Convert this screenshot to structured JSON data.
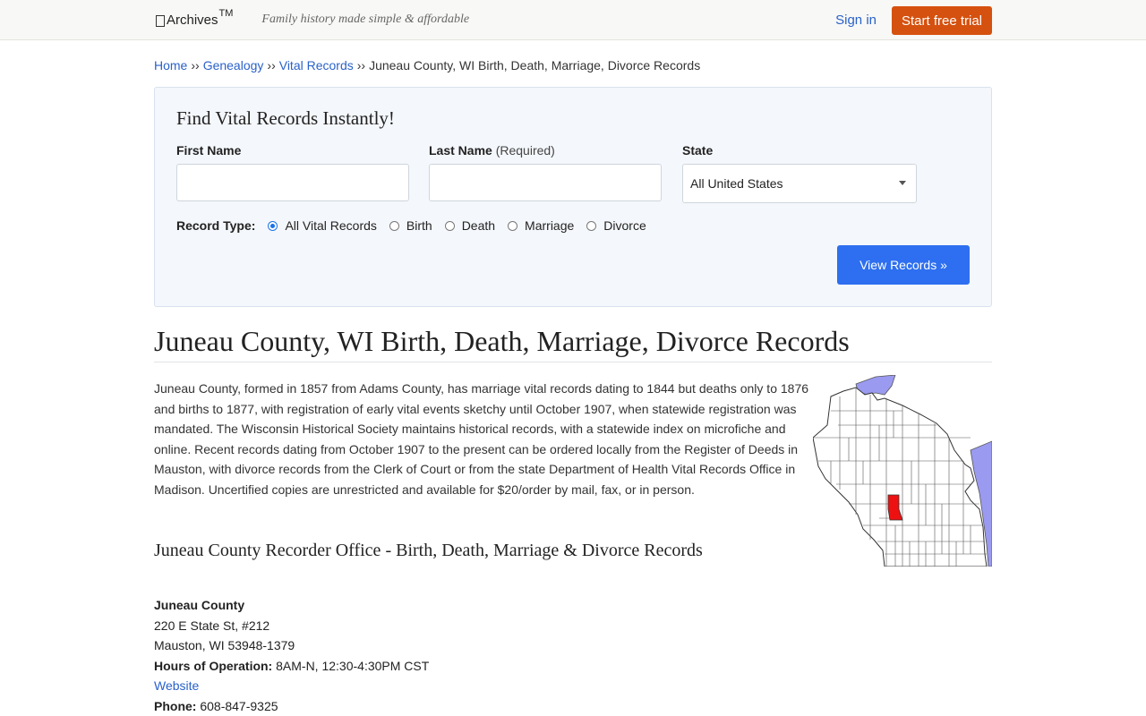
{
  "header": {
    "logo_text": "Archives",
    "logo_tm": "TM",
    "tagline": "Family history made simple & affordable",
    "signin_label": "Sign in",
    "trial_label": "Start free trial",
    "accent_color": "#d5510f"
  },
  "breadcrumb": {
    "items": [
      "Home",
      "Genealogy",
      "Vital Records"
    ],
    "separator": "››",
    "current": "Juneau County, WI Birth, Death, Marriage, Divorce Records"
  },
  "search": {
    "title": "Find Vital Records Instantly!",
    "first_name_label": "First Name",
    "last_name_label": "Last Name",
    "last_name_req": "(Required)",
    "first_name_value": "",
    "last_name_value": "",
    "state_label": "State",
    "state_value": "All United States",
    "record_type_label": "Record Type:",
    "record_types": [
      "All Vital Records",
      "Birth",
      "Death",
      "Marriage",
      "Divorce"
    ],
    "selected_record_type": "All Vital Records",
    "button_label": "View Records »",
    "button_color": "#2d6ff0"
  },
  "page": {
    "title": "Juneau County, WI Birth, Death, Marriage, Divorce Records",
    "intro": "Juneau County, formed in 1857 from Adams County, has marriage vital records dating to 1844 but deaths only to 1876 and births to 1877, with registration of early vital events sketchy until October 1907, when statewide registration was mandated. The Wisconsin Historical Society maintains historical records, with a statewide index on microfiche and online. Recent records dating from October 1907 to the present can be ordered locally from the Register of Deeds in Mauston, with divorce records from the Clerk of Court or from the state Department of Health Vital Records Office in Madison. Uncertified copies are unrestricted and available for $20/order by mail, fax, or in person.",
    "section_title": "Juneau County Recorder Office - Birth, Death, Marriage & Divorce Records"
  },
  "map": {
    "highlight_color": "#ee1111",
    "water_color": "#9a9af0"
  },
  "office": {
    "name": "Juneau County",
    "address1": "220 E State St, #212",
    "address2": "Mauston, WI 53948-1379",
    "hours_label": "Hours of Operation:",
    "hours_value": "8AM-N, 12:30-4:30PM CST",
    "website_label": "Website",
    "phone_label": "Phone:",
    "phone_value": "608-847-9325"
  }
}
